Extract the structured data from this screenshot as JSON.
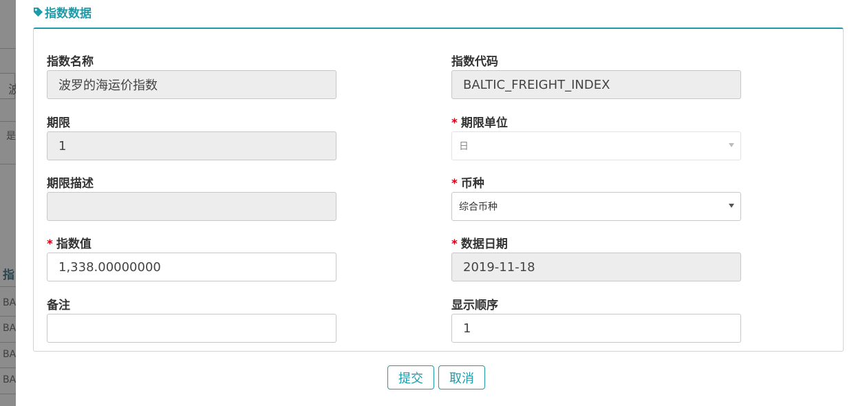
{
  "background": {
    "input_fragment": "波",
    "row_fragment": "是",
    "section_heading_fragment": "指",
    "list_rows": [
      "BA",
      "BA",
      "BA",
      "BA"
    ]
  },
  "modal": {
    "title": "指数数据",
    "icon": "tag-icon",
    "accent_color": "#1f9aa8",
    "fields": {
      "index_name": {
        "label": "指数名称",
        "value": "波罗的海运价指数",
        "required": false,
        "readonly": true
      },
      "index_code": {
        "label": "指数代码",
        "value": "BALTIC_FREIGHT_INDEX",
        "required": false,
        "readonly": true
      },
      "term": {
        "label": "期限",
        "value": "1",
        "required": false,
        "readonly": true
      },
      "term_unit": {
        "label": "期限单位",
        "value": "日",
        "required": true,
        "disabled": true
      },
      "term_desc": {
        "label": "期限描述",
        "value": "",
        "required": false,
        "readonly": true
      },
      "currency": {
        "label": "币种",
        "value": "综合币种",
        "required": true
      },
      "index_value": {
        "label": "指数值",
        "value": "1,338.00000000",
        "required": true
      },
      "data_date": {
        "label": "数据日期",
        "value": "2019-11-18",
        "required": true,
        "readonly": true
      },
      "remark": {
        "label": "备注",
        "value": "",
        "required": false
      },
      "display_order": {
        "label": "显示顺序",
        "value": "1",
        "required": false
      }
    },
    "required_mark": "*",
    "buttons": {
      "submit": "提交",
      "cancel": "取消"
    }
  }
}
